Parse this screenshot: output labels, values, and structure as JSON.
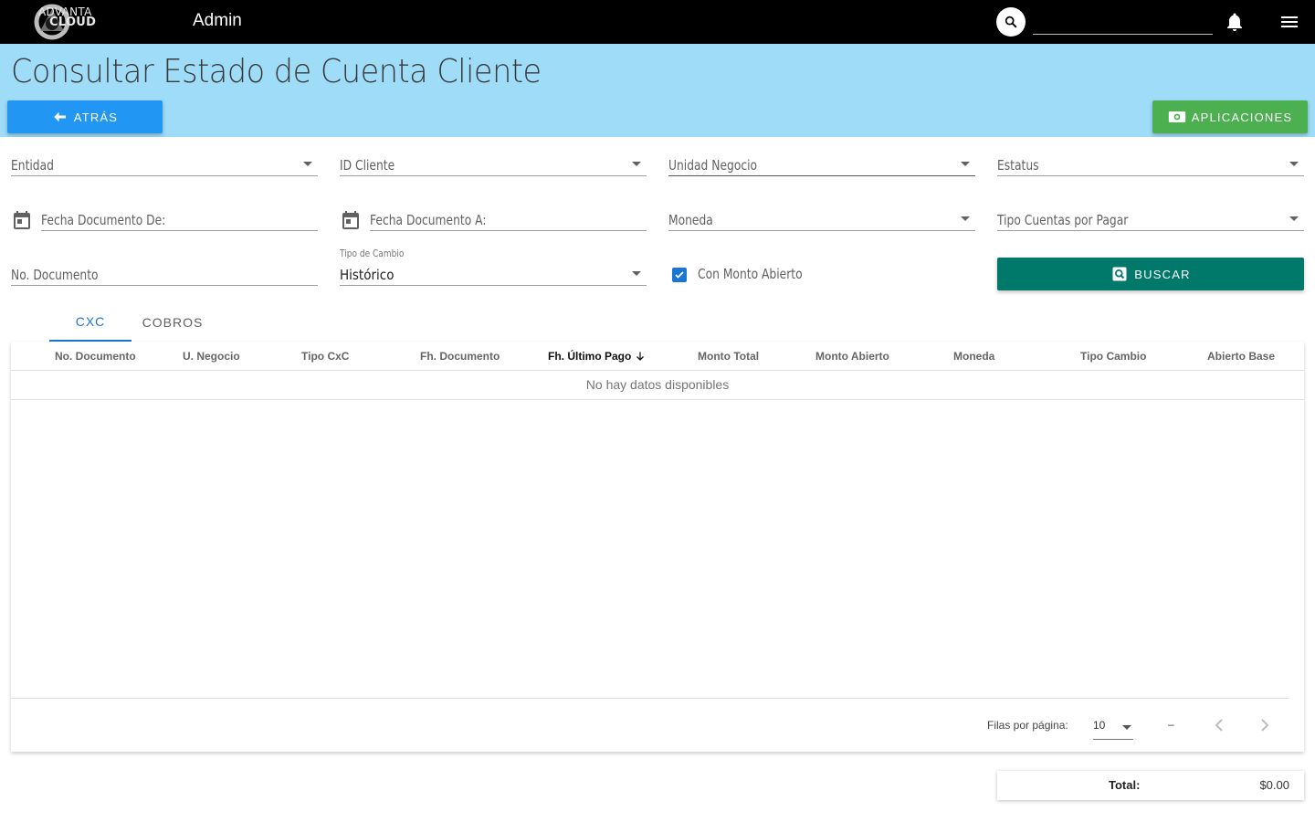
{
  "topbar": {
    "logo_line1": "ADVANTA",
    "logo_line2": "CLOUD",
    "app_name": "Admin",
    "search_value": ""
  },
  "header": {
    "title": "Consultar Estado de Cuenta Cliente",
    "back_label": "ATRÁS",
    "apps_label": "APLICACIONES"
  },
  "filters": {
    "entidad": "Entidad",
    "id_cliente": "ID Cliente",
    "unidad_negocio": "Unidad Negocio",
    "estatus": "Estatus",
    "fecha_de": "Fecha Documento De:",
    "fecha_a": "Fecha Documento A:",
    "moneda": "Moneda",
    "tipo_cuentas": "Tipo Cuentas por Pagar",
    "no_documento": "No. Documento",
    "tipo_cambio_label": "Tipo de Cambio",
    "tipo_cambio_value": "Histórico",
    "con_monto_abierto": "Con Monto Abierto",
    "con_monto_abierto_checked": true,
    "buscar_label": "BUSCAR"
  },
  "tabs": [
    {
      "label": "CXC",
      "active": true
    },
    {
      "label": "COBROS",
      "active": false
    }
  ],
  "table": {
    "columns": [
      "No. Documento",
      "U. Negocio",
      "Tipo CxC",
      "Fh. Documento",
      "Fh. Último Pago",
      "Monto Total",
      "Monto Abierto",
      "Moneda",
      "Tipo Cambio",
      "Abierto Base"
    ],
    "sorted_column": "Fh. Último Pago",
    "empty_text": "No hay datos disponibles",
    "rows": []
  },
  "pagination": {
    "rows_per_page_label": "Filas por página:",
    "rows_per_page": "10",
    "range": "–"
  },
  "total": {
    "label": "Total:",
    "value": "$0.00"
  },
  "colors": {
    "topbar": "#000000",
    "header_band": "#9edcf8",
    "back_button": "#2196f3",
    "apps_button": "#4caf50",
    "search_button": "#00796b",
    "accent": "#1976d2"
  },
  "icons": [
    "logo-icon",
    "search-icon",
    "bell-icon",
    "menu-icon",
    "arrow-left-icon",
    "cash-icon",
    "calendar-icon",
    "checkbox-check-icon",
    "search-box-icon",
    "arrow-down-icon",
    "chevron-left-icon",
    "chevron-right-icon"
  ]
}
